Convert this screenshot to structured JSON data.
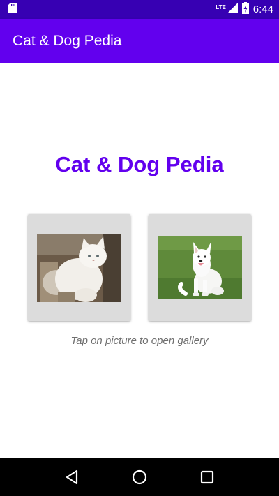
{
  "status_bar": {
    "time": "6:44",
    "network_label": "LTE",
    "icons": [
      "sd-card-icon",
      "signal-icon",
      "battery-charging-icon"
    ]
  },
  "app_bar": {
    "title": "Cat & Dog Pedia"
  },
  "main": {
    "title": "Cat & Dog Pedia",
    "cards": [
      {
        "name": "cat",
        "image": "cat-photo"
      },
      {
        "name": "dog",
        "image": "dog-photo"
      }
    ],
    "caption": "Tap on picture to open gallery"
  },
  "nav_bar": {
    "icons": [
      "back-icon",
      "home-icon",
      "recents-icon"
    ]
  },
  "colors": {
    "status_bar": "#3700b3",
    "primary": "#6200ee",
    "card": "#dcdcdc",
    "caption": "#6f6f6f"
  }
}
